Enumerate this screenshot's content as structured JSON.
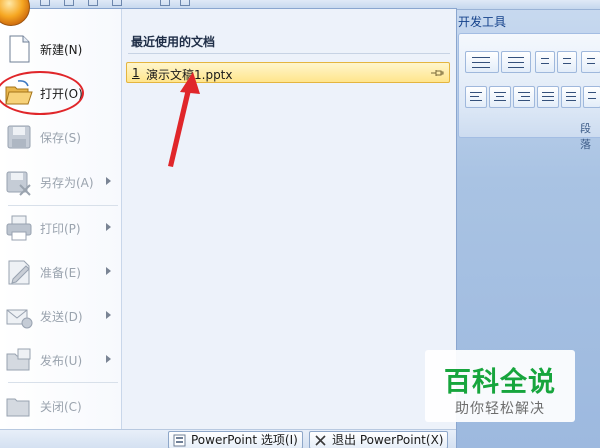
{
  "ribbon": {
    "tab_label": "开发工具",
    "group_label": "段落"
  },
  "recent": {
    "title": "最近使用的文档",
    "items": [
      {
        "number": "1",
        "name": "演示文稿1.pptx",
        "pinned": false
      }
    ]
  },
  "menu": {
    "items": [
      {
        "label": "新建(N)",
        "icon": "new-document-icon",
        "enabled": true,
        "submenu": false
      },
      {
        "label": "打开(O)",
        "icon": "open-folder-icon",
        "enabled": true,
        "submenu": false
      },
      {
        "label": "保存(S)",
        "icon": "save-icon",
        "enabled": false,
        "submenu": false
      },
      {
        "label": "另存为(A)",
        "icon": "save-as-icon",
        "enabled": false,
        "submenu": true
      },
      {
        "label": "打印(P)",
        "icon": "print-icon",
        "enabled": false,
        "submenu": true
      },
      {
        "label": "准备(E)",
        "icon": "prepare-icon",
        "enabled": false,
        "submenu": true
      },
      {
        "label": "发送(D)",
        "icon": "send-icon",
        "enabled": false,
        "submenu": true
      },
      {
        "label": "发布(U)",
        "icon": "publish-icon",
        "enabled": false,
        "submenu": true
      },
      {
        "label": "关闭(C)",
        "icon": "close-folder-icon",
        "enabled": false,
        "submenu": false
      }
    ]
  },
  "bottom": {
    "options_label": "PowerPoint 选项(I)",
    "exit_label": "退出 PowerPoint(X)"
  },
  "watermark": {
    "title": "百科全说",
    "subtitle": "助你轻松解决"
  },
  "colors": {
    "highlight": "#ffe58c",
    "annotation_red": "#e0262a",
    "watermark_green": "#17a53d"
  }
}
